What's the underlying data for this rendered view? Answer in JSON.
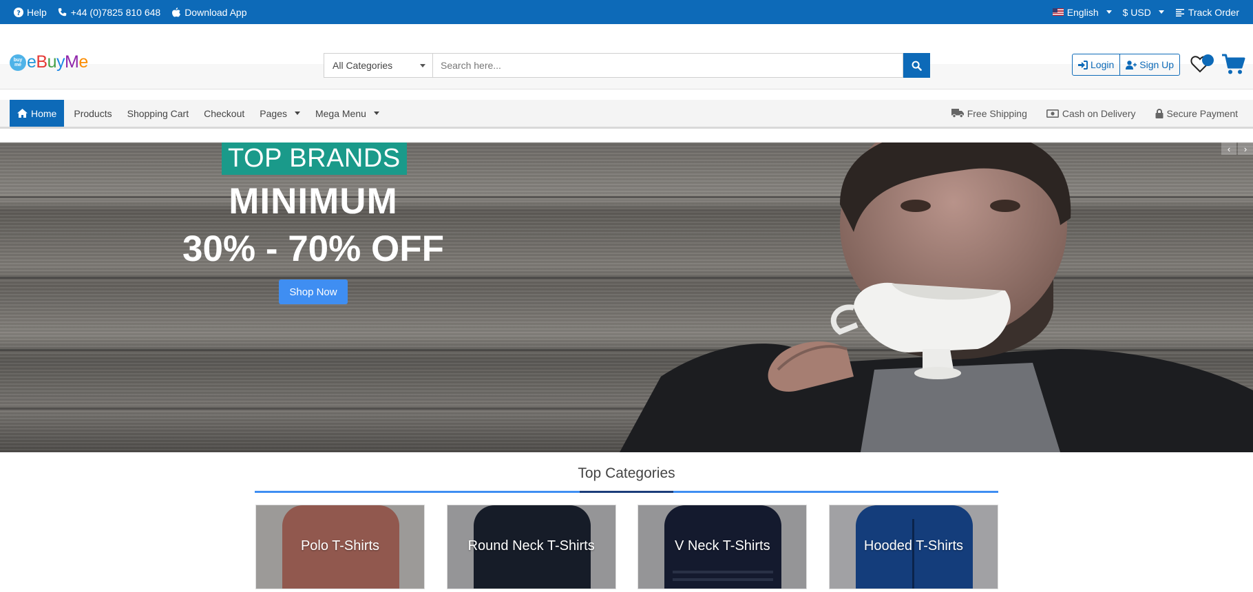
{
  "topbar": {
    "help": "Help",
    "phone": "+44 (0)7825 810 648",
    "download": "Download App",
    "language": "English",
    "currency": "$ USD",
    "track": "Track Order"
  },
  "header": {
    "logo_badge": "buy me",
    "logo_name_parts": [
      "e",
      "B",
      "u",
      "y",
      "M",
      "e"
    ],
    "category_select": "All Categories",
    "search_placeholder": "Search here...",
    "login": "Login",
    "signup": "Sign Up"
  },
  "nav": {
    "home": "Home",
    "products": "Products",
    "cart": "Shopping Cart",
    "checkout": "Checkout",
    "pages": "Pages",
    "mega": "Mega Menu",
    "free_shipping": "Free Shipping",
    "cod": "Cash on Delivery",
    "secure": "Secure Payment"
  },
  "hero": {
    "tag": "TOP BRANDS",
    "line1": "MINIMUM",
    "line2": "30% - 70% OFF",
    "cta": "Shop Now",
    "prev": "‹",
    "next": "›"
  },
  "categories": {
    "title": "Top Categories",
    "items": [
      {
        "label": "Polo T-Shirts",
        "color": "#c97a6c"
      },
      {
        "label": "Round Neck T-Shirts",
        "color": "#1f2738"
      },
      {
        "label": "V Neck T-Shirts",
        "color": "#1c2540"
      },
      {
        "label": "Hooded T-Shirts",
        "color": "#1a4f9e"
      }
    ]
  },
  "colors": {
    "brand": "#0d6ab8",
    "accent": "#3f8ef2",
    "tag": "#1a9a8a"
  }
}
